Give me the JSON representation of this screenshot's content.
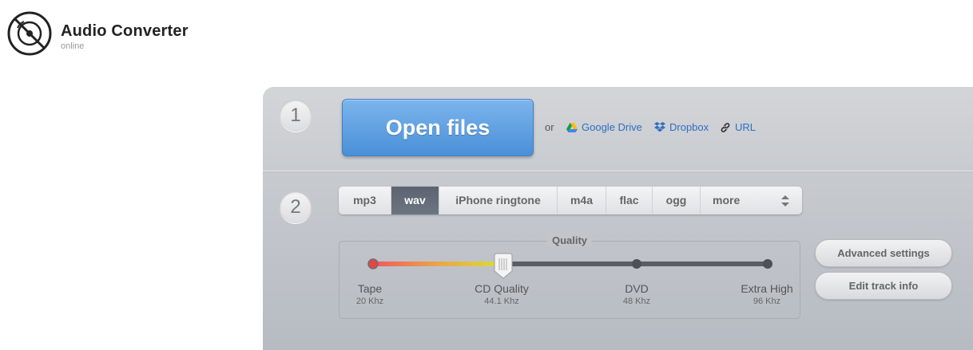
{
  "brand": {
    "title": "Audio Converter",
    "subtitle": "online",
    "icon": "vinyl-disc-icon"
  },
  "step1": {
    "number": "1",
    "open_files_label": "Open files",
    "or_label": "or",
    "sources": [
      {
        "label": "Google Drive",
        "icon": "google-drive-icon"
      },
      {
        "label": "Dropbox",
        "icon": "dropbox-icon"
      },
      {
        "label": "URL",
        "icon": "link-icon"
      }
    ]
  },
  "step2": {
    "number": "2",
    "formats": [
      "mp3",
      "wav",
      "iPhone ringtone",
      "m4a",
      "flac",
      "ogg"
    ],
    "selected_format": "wav",
    "more_label": "more",
    "quality": {
      "legend": "Quality",
      "selected_index": 1,
      "levels": [
        {
          "name": "Tape",
          "rate": "20 Khz"
        },
        {
          "name": "CD Quality",
          "rate": "44.1 Khz"
        },
        {
          "name": "DVD",
          "rate": "48 Khz"
        },
        {
          "name": "Extra High",
          "rate": "96 Khz"
        }
      ]
    },
    "advanced_settings_label": "Advanced settings",
    "edit_track_info_label": "Edit track info"
  },
  "colors": {
    "accent_blue": "#4a8fd8",
    "link_blue": "#2f6fc0",
    "active_format": "#5b6470"
  }
}
